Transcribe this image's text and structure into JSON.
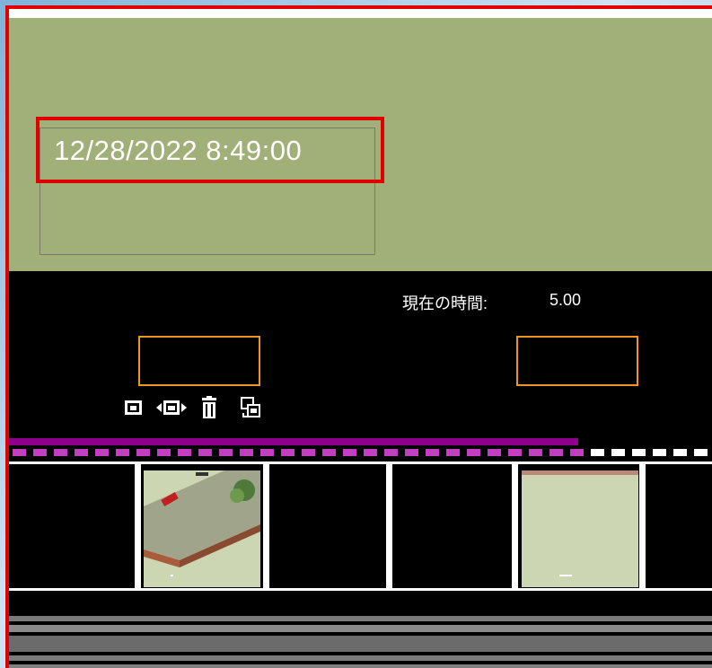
{
  "preview": {
    "date_time": "12/28/2022 8:49:00"
  },
  "timeline": {
    "current_time_label": "現在の時間:",
    "current_time_value": "5.00"
  },
  "toolbar": {
    "icons": [
      "add-photo-icon",
      "move-photo-icon",
      "trash-icon",
      "replace-photo-icon"
    ]
  },
  "colors": {
    "preview_bg": "#a1af79",
    "highlight": "#e00000",
    "orange_marker": "#f0961e",
    "progress": "#8c008c"
  },
  "progress": {
    "fraction": 0.81
  }
}
